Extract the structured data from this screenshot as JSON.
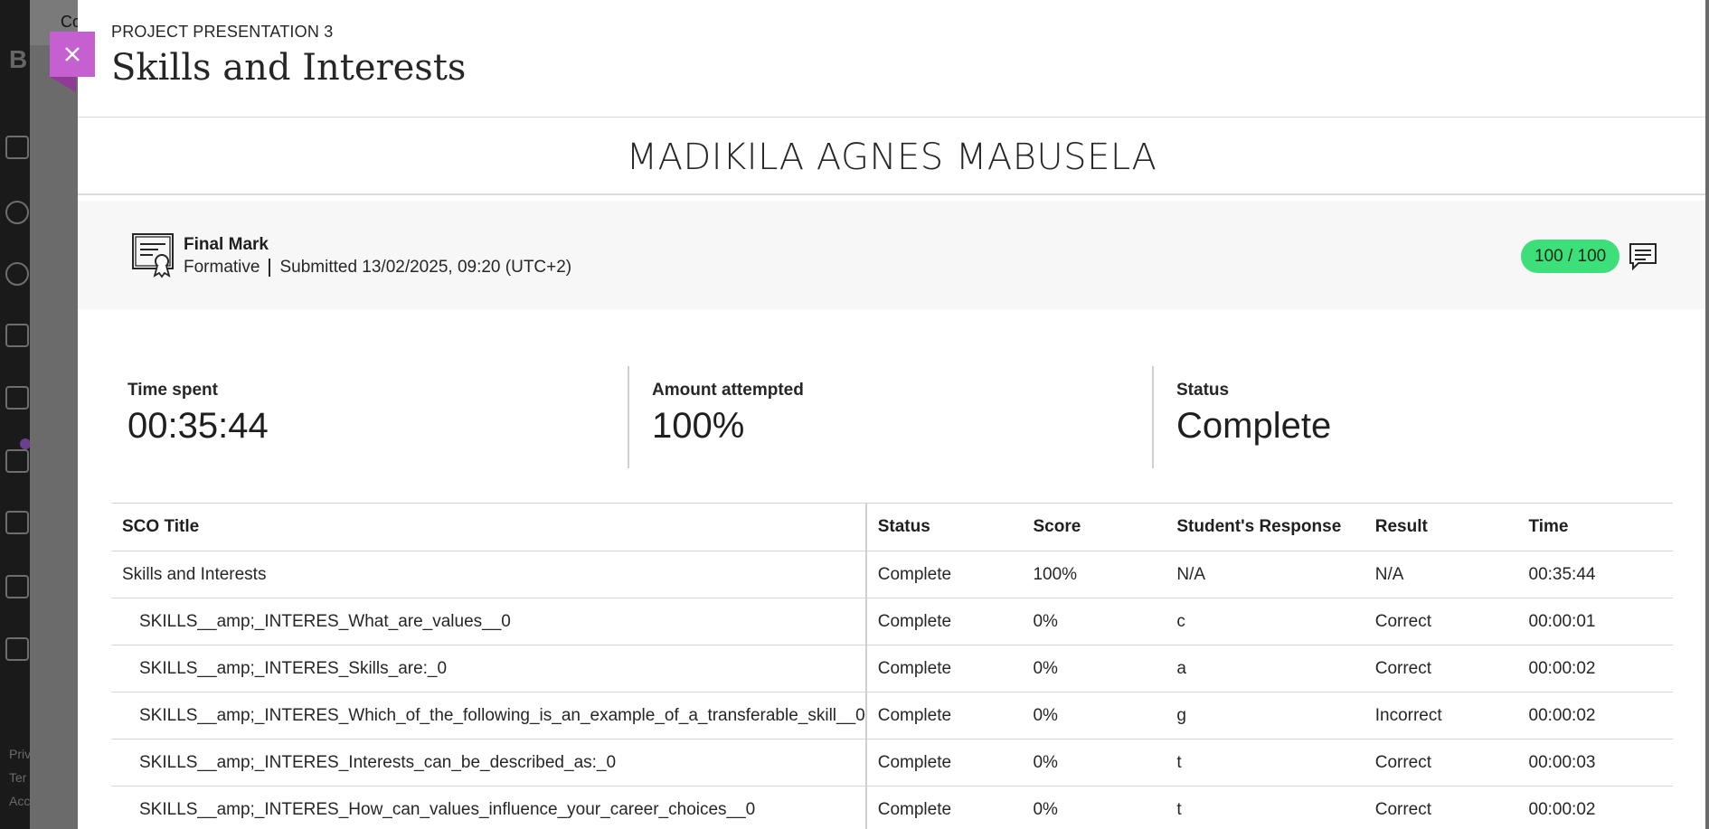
{
  "background": {
    "topbar_text": "Co",
    "brand": "B",
    "footer": [
      "Priv",
      "Ter",
      "Acc"
    ]
  },
  "panel": {
    "eyebrow": "PROJECT PRESENTATION 3",
    "title": "Skills and Interests",
    "close_label": "×",
    "student_name": "MADIKILA AGNES MABUSELA",
    "final_mark": {
      "title": "Final Mark",
      "type": "Formative",
      "submitted": "Submitted 13/02/2025, 09:20 (UTC+2)",
      "score": "100 / 100"
    },
    "stats": [
      {
        "label": "Time spent",
        "value": "00:35:44"
      },
      {
        "label": "Amount attempted",
        "value": "100%"
      },
      {
        "label": "Status",
        "value": "Complete"
      }
    ],
    "table": {
      "headers": [
        "SCO Title",
        "Status",
        "Score",
        "Student's Response",
        "Result",
        "Time"
      ],
      "rows": [
        [
          "Skills and Interests",
          "Complete",
          "100%",
          "N/A",
          "N/A",
          "00:35:44"
        ],
        [
          "SKILLS__amp;_INTERES_What_are_values__0",
          "Complete",
          "0%",
          "c",
          "Correct",
          "00:00:01"
        ],
        [
          "SKILLS__amp;_INTERES_Skills_are:_0",
          "Complete",
          "0%",
          "a",
          "Correct",
          "00:00:02"
        ],
        [
          "SKILLS__amp;_INTERES_Which_of_the_following_is_an_example_of_a_transferable_skill__0",
          "Complete",
          "0%",
          "g",
          "Incorrect",
          "00:00:02"
        ],
        [
          "SKILLS__amp;_INTERES_Interests_can_be_described_as:_0",
          "Complete",
          "0%",
          "t",
          "Correct",
          "00:00:03"
        ],
        [
          "SKILLS__amp;_INTERES_How_can_values_influence_your_career_choices__0",
          "Complete",
          "0%",
          "t",
          "Correct",
          "00:00:02"
        ]
      ]
    }
  },
  "colors": {
    "close_button": "#c660d1",
    "score_pill": "#3ddf7a"
  },
  "icons": {
    "close": "close-icon",
    "certificate": "certificate-icon",
    "feedback": "feedback-icon"
  }
}
